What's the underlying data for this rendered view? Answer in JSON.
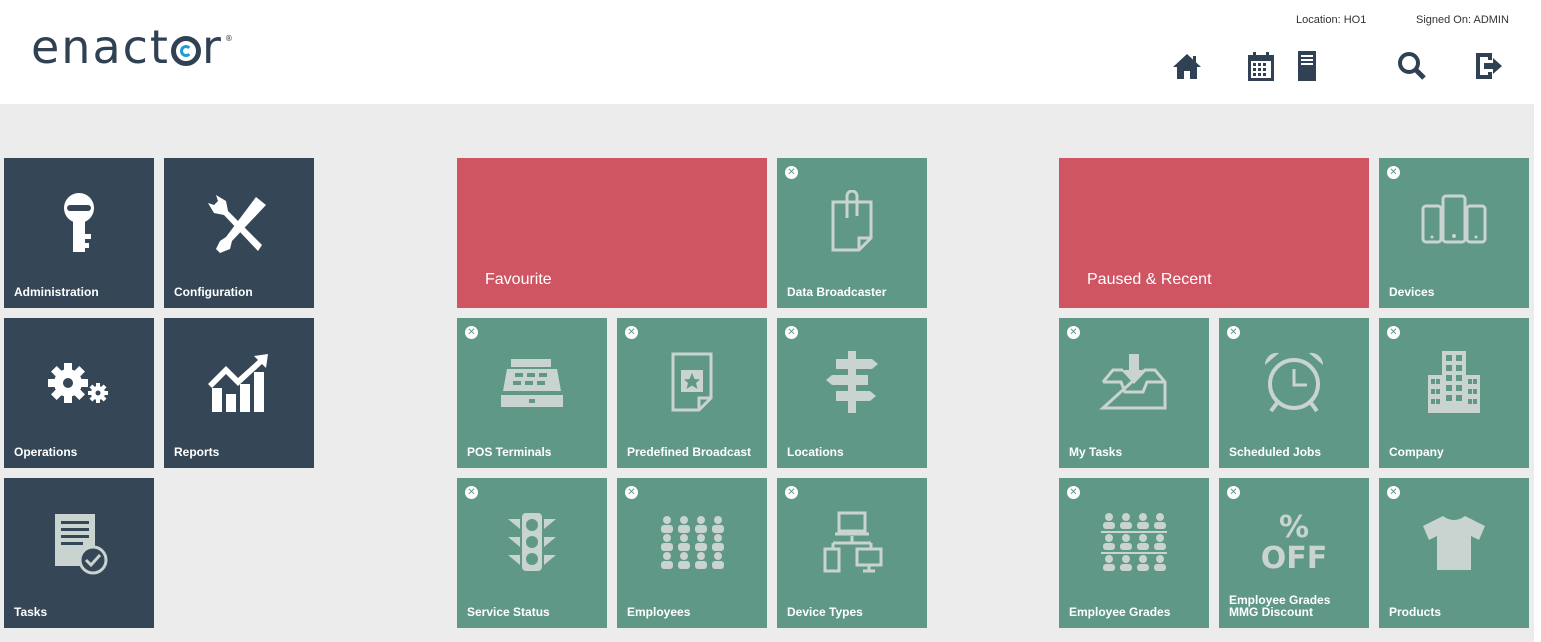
{
  "header": {
    "logo_text_a": "enact",
    "logo_text_b": "r",
    "location": "Location: HO1",
    "signed_on": "Signed On: ADMIN"
  },
  "nav_icons": [
    "home-icon",
    "calendar-icon",
    "server-icon",
    "search-icon",
    "logout-icon"
  ],
  "tiles": {
    "administration": "Administration",
    "configuration": "Configuration",
    "operations": "Operations",
    "reports": "Reports",
    "tasks": "Tasks",
    "favourite": "Favourite",
    "data_broadcaster": "Data Broadcaster",
    "pos_terminals": "POS Terminals",
    "predefined_broadcast": "Predefined Broadcast",
    "locations": "Locations",
    "service_status": "Service Status",
    "employees": "Employees",
    "device_types": "Device Types",
    "paused_recent": "Paused & Recent",
    "devices": "Devices",
    "my_tasks": "My Tasks",
    "scheduled_jobs": "Scheduled Jobs",
    "company": "Company",
    "employee_grades": "Employee Grades",
    "employee_grades_mmg_line1": "Employee Grades",
    "employee_grades_mmg_line2": "MMG Discount",
    "products": "Products",
    "percent_off_top": "%",
    "percent_off_bottom": "OFF"
  },
  "colors": {
    "dark_tile": "#354657",
    "green_tile": "#5f9886",
    "red_tile": "#cf5563",
    "background": "#ececec",
    "icon_light": "#c9d3d0"
  },
  "close_glyph": "✕"
}
